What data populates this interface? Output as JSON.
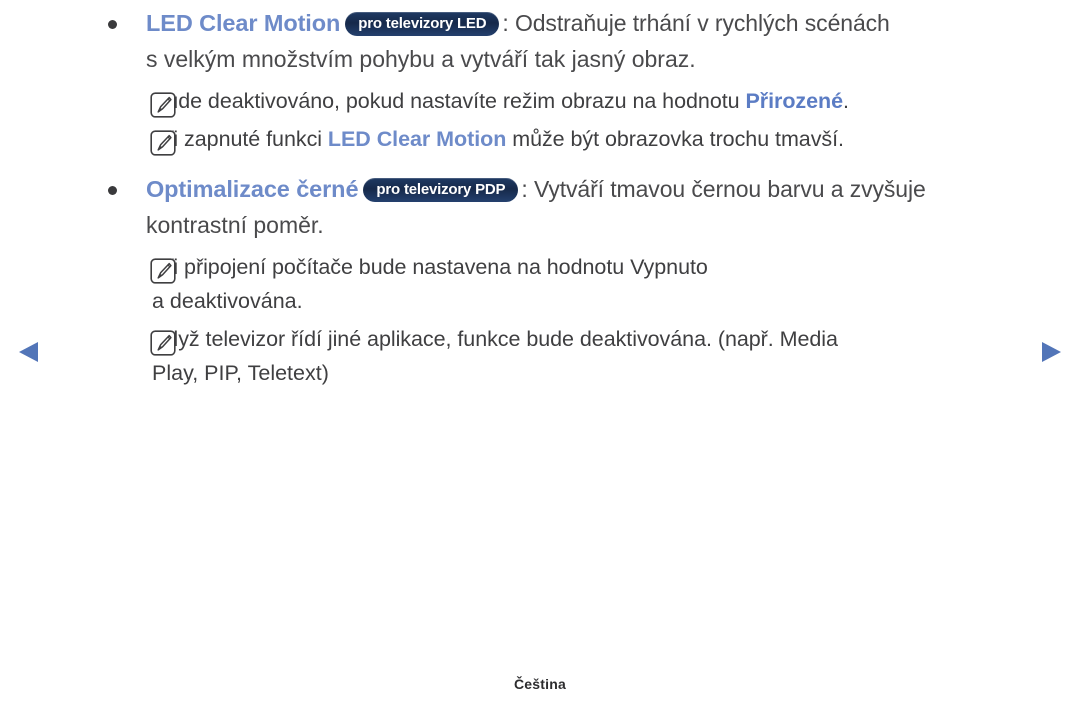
{
  "page": {
    "language_footer": "Čeština"
  },
  "nav": {
    "prev_label": "prev-page-arrow",
    "next_label": "next-page-arrow"
  },
  "sections": [
    {
      "term": "LED Clear Motion",
      "badge": "pro televizory LED",
      "desc_line1": ": Odstraňuje trhání v rychlých scénách",
      "desc_line2": "s velkým množstvím pohybu a vytváří tak jasný obraz.",
      "notes": [
        {
          "prefix": "Bude deaktivováno, pokud nastavíte režim obrazu na hodnotu ",
          "highlight": "Přirozené",
          "suffix": "."
        },
        {
          "prefix": "Při zapnuté funkci ",
          "highlight": "LED Clear Motion",
          "suffix": " může být obrazovka trochu tmavší."
        }
      ]
    },
    {
      "term": "Optimalizace černé",
      "badge": "pro televizory PDP",
      "desc_line1": ": Vytváří tmavou černou barvu a zvyšuje",
      "desc_line2": "kontrastní poměr.",
      "notes": [
        {
          "prefix": "Při připojení počítače bude nastavena na hodnotu Vypnuto",
          "continuation": "a deaktivována."
        },
        {
          "prefix": "Když televizor řídí jiné aplikace, funkce bude deaktivována. (např. Media",
          "continuation": "Play, PIP, Teletext)"
        }
      ]
    }
  ],
  "colors": {
    "term_blue": "#6e8bc9",
    "highlight_blue": "#5b7cc4",
    "badge_navy": "#16294a",
    "arrow_blue": "#5275b8",
    "body_text": "#3f3f41"
  }
}
